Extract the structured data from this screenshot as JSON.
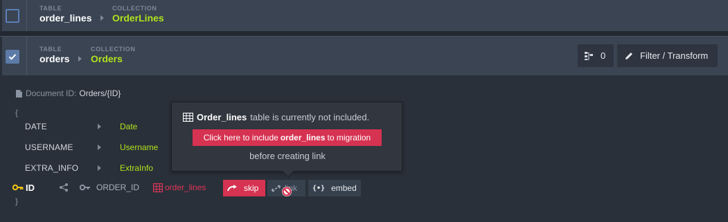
{
  "rows": [
    {
      "table_caption": "TABLE",
      "table_name": "order_lines",
      "collection_caption": "COLLECTION",
      "collection_name": "OrderLines",
      "checked": false
    },
    {
      "table_caption": "TABLE",
      "table_name": "orders",
      "collection_caption": "COLLECTION",
      "collection_name": "Orders",
      "checked": true,
      "links_count": "0",
      "filter_label": "Filter / Transform"
    }
  ],
  "document": {
    "id_label": "Document ID:",
    "id_value": "Orders/{ID}",
    "open_brace": "{",
    "close_brace": "}"
  },
  "fields": [
    {
      "name": "DATE",
      "target": "Date"
    },
    {
      "name": "USERNAME",
      "target": "Username"
    },
    {
      "name": "EXTRA_INFO",
      "target": "ExtraInfo"
    }
  ],
  "id_row": {
    "id_label": "ID",
    "fk_label": "ORDER_ID",
    "ref_table": "order_lines",
    "skip_label": "skip",
    "link_label": "link",
    "embed_label": "embed"
  },
  "tooltip": {
    "table_name": "Order_lines",
    "message": "table is currently not included.",
    "button_prefix": "Click here to include",
    "button_table": "order_lines",
    "button_suffix": "to migration",
    "footer": "before creating link"
  },
  "colors": {
    "accent_green": "#b0e21c",
    "accent_red": "#d63251",
    "key_yellow": "#f1c40f"
  }
}
